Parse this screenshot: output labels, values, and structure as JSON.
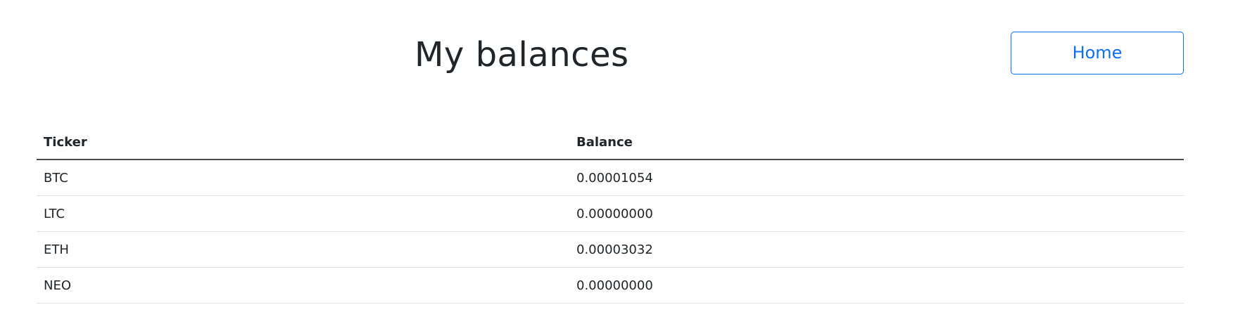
{
  "header": {
    "title": "My balances",
    "home_label": "Home"
  },
  "table": {
    "columns": [
      "Ticker",
      "Balance"
    ],
    "rows": [
      {
        "ticker": "BTC",
        "balance": "0.00001054"
      },
      {
        "ticker": "LTC",
        "balance": "0.00000000"
      },
      {
        "ticker": "ETH",
        "balance": "0.00003032"
      },
      {
        "ticker": "NEO",
        "balance": "0.00000000"
      }
    ]
  },
  "colors": {
    "text": "#212529",
    "accent": "#0d6efd",
    "row_border": "#dee2e6"
  }
}
